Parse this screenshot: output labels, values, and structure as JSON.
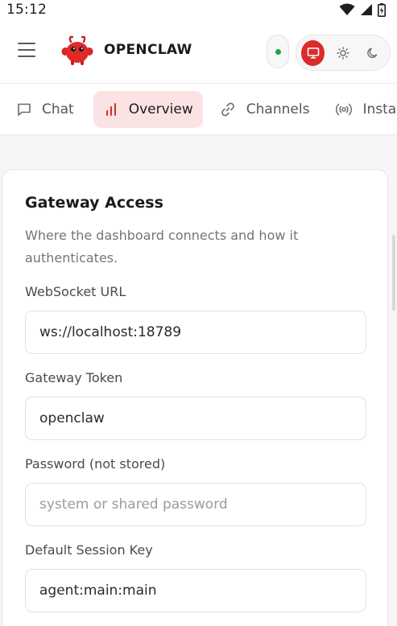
{
  "status_bar": {
    "time": "15:12"
  },
  "header": {
    "brand": "OPENCLAW",
    "connection_status_color": "#22a447",
    "theme_modes": [
      "system-monitor-icon",
      "sun-icon",
      "moon-icon"
    ],
    "active_theme": "system"
  },
  "tabs": [
    {
      "label": "Chat",
      "icon": "chat-bubble-icon",
      "active": false
    },
    {
      "label": "Overview",
      "icon": "bar-chart-icon",
      "active": true
    },
    {
      "label": "Channels",
      "icon": "link-icon",
      "active": false
    },
    {
      "label": "Insta",
      "icon": "broadcast-icon",
      "active": false
    }
  ],
  "gateway_access": {
    "title": "Gateway Access",
    "description": "Where the dashboard connects and how it authenticates.",
    "fields": [
      {
        "label": "WebSocket URL",
        "value": "ws://localhost:18789",
        "placeholder": ""
      },
      {
        "label": "Gateway Token",
        "value": "openclaw",
        "placeholder": ""
      },
      {
        "label": "Password (not stored)",
        "value": "",
        "placeholder": "system or shared password"
      },
      {
        "label": "Default Session Key",
        "value": "agent:main:main",
        "placeholder": ""
      }
    ]
  },
  "colors": {
    "accent": "#dc2b2b",
    "accent_soft": "#fbe3e3"
  }
}
